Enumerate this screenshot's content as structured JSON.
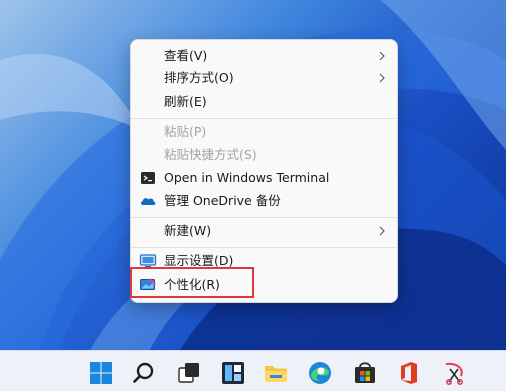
{
  "menu": {
    "view": "查看(V)",
    "sort": "排序方式(O)",
    "refresh": "刷新(E)",
    "paste": "粘贴(P)",
    "paste_shortcut": "粘贴快捷方式(S)",
    "open_terminal": "Open in Windows Terminal",
    "onedrive": "管理 OneDrive 备份",
    "new": "新建(W)",
    "display_settings": "显示设置(D)",
    "personalize": "个性化(R)"
  },
  "disabled_items": [
    "paste",
    "paste_shortcut"
  ],
  "highlighted_item": "personalize",
  "taskbar_icons": [
    "windows-start-icon",
    "search-icon",
    "task-view-icon",
    "widgets-icon",
    "file-explorer-icon",
    "edge-icon",
    "microsoft-store-icon",
    "office-icon",
    "snipping-tool-icon"
  ],
  "colors": {
    "highlight": "#e0373c",
    "accent": "#0067c0",
    "menu_bg": "#f9f9f9"
  }
}
